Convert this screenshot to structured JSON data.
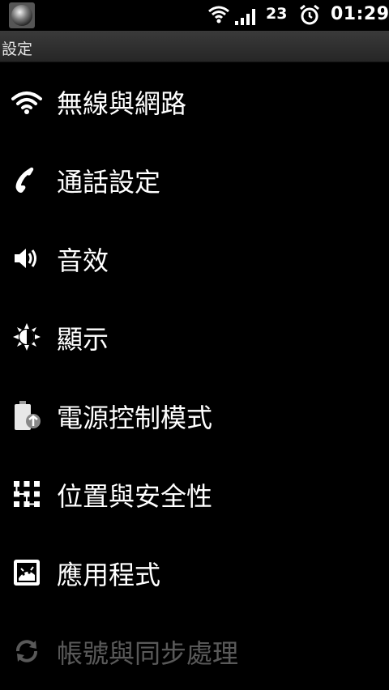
{
  "status_bar": {
    "battery_level": "23",
    "time": "01:29",
    "icons": [
      "app-orb-icon",
      "wifi-icon",
      "signal-icon",
      "alarm-icon"
    ]
  },
  "title_bar": {
    "title": "設定"
  },
  "menu": {
    "items": [
      {
        "label": "無線與網路",
        "icon": "wifi-icon"
      },
      {
        "label": "通話設定",
        "icon": "phone-icon"
      },
      {
        "label": "音效",
        "icon": "speaker-icon"
      },
      {
        "label": "顯示",
        "icon": "brightness-icon"
      },
      {
        "label": "電源控制模式",
        "icon": "battery-power-icon"
      },
      {
        "label": "位置與安全性",
        "icon": "pattern-lock-icon"
      },
      {
        "label": "應用程式",
        "icon": "applications-icon"
      },
      {
        "label": "帳號與同步處理",
        "icon": "sync-icon"
      }
    ]
  }
}
